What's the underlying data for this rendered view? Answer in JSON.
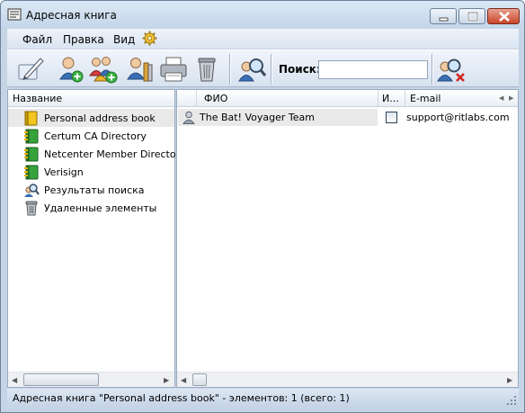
{
  "window": {
    "title": "Адресная книга"
  },
  "menu": {
    "items": [
      "Файл",
      "Правка",
      "Вид"
    ]
  },
  "toolbar": {
    "search_label": "Поиск:",
    "search_value": "",
    "buttons": [
      "new-message-icon",
      "add-contact-icon",
      "add-group-icon",
      "properties-icon",
      "print-icon",
      "delete-icon",
      "find-icon",
      "clear-search-icon"
    ]
  },
  "tree": {
    "header": "Название",
    "items": [
      {
        "label": "Personal address book",
        "icon": "book-yellow-icon",
        "selected": true
      },
      {
        "label": "Certum CA Directory",
        "icon": "book-green-icon"
      },
      {
        "label": "Netcenter Member Directory",
        "icon": "book-green-icon"
      },
      {
        "label": "Verisign",
        "icon": "book-green-icon"
      },
      {
        "label": "Результаты поиска",
        "icon": "search-results-icon"
      },
      {
        "label": "Удаленные элементы",
        "icon": "trash-icon"
      }
    ]
  },
  "contacts": {
    "headers": {
      "name": "ФИО",
      "im": "И...",
      "email": "E-mail"
    },
    "rows": [
      {
        "name": "The Bat! Voyager Team",
        "email": "support@ritlabs.com"
      }
    ]
  },
  "status": {
    "text": "Адресная книга \"Personal address book\" - элементов: 1 (всего: 1)"
  },
  "colors": {
    "title_bg": "#c4d6ea",
    "selection": "#e9e9e9",
    "accent": "#1f5fa8"
  }
}
